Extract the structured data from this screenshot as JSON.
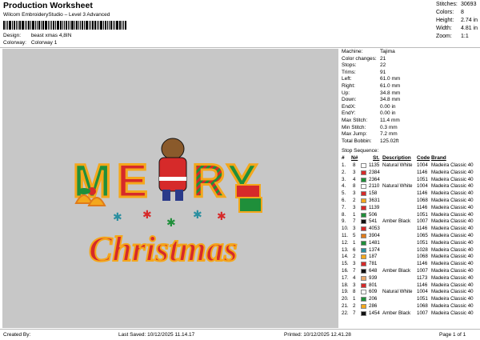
{
  "header": {
    "title": "Production Worksheet",
    "subtitle": "Wilcom EmbroideryStudio – Level 3 Advanced",
    "design_label": "Design:",
    "design_value": "beast xmas 4,8IN",
    "colorway_label": "Colorway:",
    "colorway_value": "Colorway 1"
  },
  "stats": [
    {
      "label": "Stitches:",
      "value": "30693"
    },
    {
      "label": "Colors:",
      "value": "8"
    },
    {
      "label": "Height:",
      "value": "2.74 in"
    },
    {
      "label": "Width:",
      "value": "4.81 in"
    },
    {
      "label": "Zoom:",
      "value": "1:1"
    }
  ],
  "machine_info": [
    {
      "label": "Machine:",
      "value": "Tajima"
    },
    {
      "label": "Color changes:",
      "value": "21"
    },
    {
      "label": "Stops:",
      "value": "22"
    },
    {
      "label": "Trims:",
      "value": "91"
    },
    {
      "label": "Left:",
      "value": "61.0 mm"
    },
    {
      "label": "Right:",
      "value": "61.0 mm"
    },
    {
      "label": "Up:",
      "value": "34.8 mm"
    },
    {
      "label": "Down:",
      "value": "34.8 mm"
    },
    {
      "label": "EndX:",
      "value": "0.00 in"
    },
    {
      "label": "EndY:",
      "value": "0.00 in"
    },
    {
      "label": "Max Stitch:",
      "value": "11.4 mm"
    },
    {
      "label": "Min Stitch:",
      "value": "0.3 mm"
    },
    {
      "label": "Max Jump:",
      "value": "7.2 mm"
    },
    {
      "label": "Total Bobbin:",
      "value": "125.02ft"
    }
  ],
  "sequence": {
    "title": "Stop Sequence:",
    "headers": {
      "num": "#",
      "n": "N#",
      "st": "St.",
      "desc": "Description",
      "code": "Code",
      "brand": "Brand"
    },
    "rows": [
      {
        "num": "1.",
        "n": "8",
        "color": "#ffffff",
        "st": "1135",
        "desc": "Natural White",
        "code": "1004",
        "brand": "Madeira Classic 40"
      },
      {
        "num": "2.",
        "n": "3",
        "color": "#d62a2a",
        "st": "2384",
        "desc": "",
        "code": "1146",
        "brand": "Madeira Classic 40"
      },
      {
        "num": "3.",
        "n": "4",
        "color": "#1f8f3a",
        "st": "2364",
        "desc": "",
        "code": "1051",
        "brand": "Madeira Classic 40"
      },
      {
        "num": "4.",
        "n": "8",
        "color": "#ffffff",
        "st": "2110",
        "desc": "Natural White",
        "code": "1004",
        "brand": "Madeira Classic 40"
      },
      {
        "num": "5.",
        "n": "3",
        "color": "#d62a2a",
        "st": "158",
        "desc": "",
        "code": "1146",
        "brand": "Madeira Classic 40"
      },
      {
        "num": "6.",
        "n": "2",
        "color": "#f4a71c",
        "st": "3631",
        "desc": "",
        "code": "1068",
        "brand": "Madeira Classic 40"
      },
      {
        "num": "7.",
        "n": "3",
        "color": "#d62a2a",
        "st": "1139",
        "desc": "",
        "code": "1146",
        "brand": "Madeira Classic 40"
      },
      {
        "num": "8.",
        "n": "1",
        "color": "#1f8f3a",
        "st": "506",
        "desc": "",
        "code": "1051",
        "brand": "Madeira Classic 40"
      },
      {
        "num": "9.",
        "n": "7",
        "color": "#111111",
        "st": "541",
        "desc": "Amber Black",
        "code": "1007",
        "brand": "Madeira Classic 40"
      },
      {
        "num": "10.",
        "n": "3",
        "color": "#d62a2a",
        "st": "4053",
        "desc": "",
        "code": "1146",
        "brand": "Madeira Classic 40"
      },
      {
        "num": "11.",
        "n": "5",
        "color": "#e07b1a",
        "st": "3904",
        "desc": "",
        "code": "1065",
        "brand": "Madeira Classic 40"
      },
      {
        "num": "12.",
        "n": "1",
        "color": "#1f8f3a",
        "st": "1481",
        "desc": "",
        "code": "1051",
        "brand": "Madeira Classic 40"
      },
      {
        "num": "13.",
        "n": "6",
        "color": "#2a8fa0",
        "st": "1374",
        "desc": "",
        "code": "1028",
        "brand": "Madeira Classic 40"
      },
      {
        "num": "14.",
        "n": "2",
        "color": "#f4a71c",
        "st": "187",
        "desc": "",
        "code": "1068",
        "brand": "Madeira Classic 40"
      },
      {
        "num": "15.",
        "n": "3",
        "color": "#d62a2a",
        "st": "781",
        "desc": "",
        "code": "1146",
        "brand": "Madeira Classic 40"
      },
      {
        "num": "16.",
        "n": "7",
        "color": "#111111",
        "st": "648",
        "desc": "Amber Black",
        "code": "1007",
        "brand": "Madeira Classic 40"
      },
      {
        "num": "17.",
        "n": "4",
        "color": "#e8a86a",
        "st": "939",
        "desc": "",
        "code": "1173",
        "brand": "Madeira Classic 40"
      },
      {
        "num": "18.",
        "n": "3",
        "color": "#d62a2a",
        "st": "801",
        "desc": "",
        "code": "1146",
        "brand": "Madeira Classic 40"
      },
      {
        "num": "19.",
        "n": "8",
        "color": "#ffffff",
        "st": "609",
        "desc": "Natural White",
        "code": "1004",
        "brand": "Madeira Classic 40"
      },
      {
        "num": "20.",
        "n": "1",
        "color": "#1f8f3a",
        "st": "206",
        "desc": "",
        "code": "1051",
        "brand": "Madeira Classic 40"
      },
      {
        "num": "21.",
        "n": "2",
        "color": "#f4a71c",
        "st": "286",
        "desc": "",
        "code": "1068",
        "brand": "Madeira Classic 40"
      },
      {
        "num": "22.",
        "n": "7",
        "color": "#111111",
        "st": "1454",
        "desc": "Amber Black",
        "code": "1007",
        "brand": "Madeira Classic 40"
      }
    ]
  },
  "footer": {
    "created_by": "Created By:",
    "last_saved": "Last Saved: 10/12/2025 11.14.17",
    "printed": "Printed: 10/12/2025 12.41.28",
    "page": "Page 1 of 1"
  },
  "design_preview": {
    "line1": "MERRY",
    "line2": "Christmas",
    "colors": {
      "bg": "#c7c7c7",
      "red": "#d62a2a",
      "green": "#1f8f3a",
      "gold": "#f4a71c",
      "orange": "#e07b1a"
    }
  }
}
